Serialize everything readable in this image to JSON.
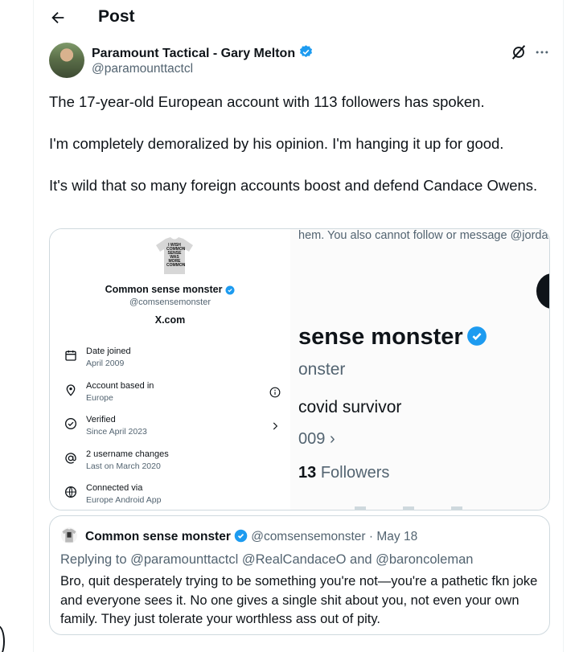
{
  "header": {
    "title": "Post"
  },
  "post": {
    "author_name": "Paramount Tactical - Gary Melton",
    "author_handle": "@paramounttactcl",
    "paragraphs": [
      "The 17-year-old European account with 113 followers has spoken.",
      "I'm completely demoralized by his opinion. I'm hanging it up for good.",
      "It's wild that so many foreign accounts boost and defend Candace Owens."
    ]
  },
  "media": {
    "shirt_text": "I WISH COMMON SENSE WAS MORE COMMON",
    "profile_name": "Common sense monster",
    "profile_handle": "@comsensemonster",
    "site": "X.com",
    "rows": [
      {
        "label": "Date joined",
        "sub": "April 2009",
        "icon": "calendar-icon"
      },
      {
        "label": "Account based in",
        "sub": "Europe",
        "icon": "location-pin-icon"
      },
      {
        "label": "Verified",
        "sub": "Since April 2023",
        "icon": "verified-check-icon"
      },
      {
        "label": "2 username changes",
        "sub": "Last on March 2020",
        "icon": "at-sign-icon"
      },
      {
        "label": "Connected via",
        "sub": "Europe Android App",
        "icon": "globe-icon"
      }
    ],
    "zoom": {
      "note": "hem. You also cannot follow or message @jorda",
      "name": "sense monster",
      "handle": "onster",
      "bio": "covid survivor",
      "date": "009",
      "followers_count": "13",
      "followers_label": "Followers"
    }
  },
  "quote": {
    "name": "Common sense monster",
    "handle": "@comsensemonster",
    "date": "May 18",
    "reply_to": "Replying to @paramounttactcl @RealCandaceO and @baroncoleman",
    "text": "Bro, quit desperately trying to be something you're not—you're a pathetic fkn joke and everyone sees it. No one gives a single shit about you, not even your own family. They just tolerate your worthless ass out of pity."
  },
  "colors": {
    "verified_blue": "#1d9bf0",
    "text": "#0f1419",
    "secondary": "#536471",
    "border": "#cfd9de"
  }
}
